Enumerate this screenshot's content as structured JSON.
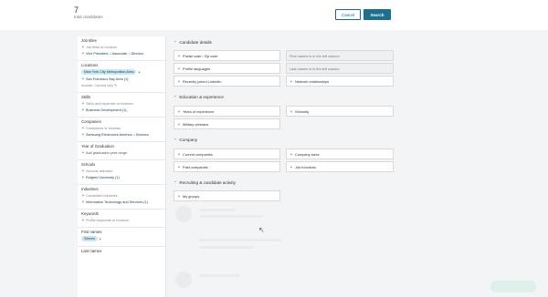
{
  "header": {
    "count": "7",
    "count_label": "total candidates",
    "cancel_label": "Cancel",
    "search_label": "Search"
  },
  "sidebar": {
    "job_titles": {
      "title": "Job titles",
      "placeholder": "Job titles or boolean",
      "value": "Vice President, • Associate, • Director,"
    },
    "locations": {
      "title": "Locations",
      "pill": "New York City Metropolitan Area",
      "value": "San Francisco Bay Area (1),",
      "include": "Include: Current only"
    },
    "skills": {
      "title": "Skills",
      "placeholder": "Skills and expertise or boolean",
      "value": "Business Development (1),"
    },
    "companies": {
      "title": "Companies",
      "placeholder": "Companies or boolean",
      "value": "Samsung Electronics America, • Nomura,"
    },
    "year_of_graduation": {
      "title": "Year of Graduation",
      "add": "Add graduation year range"
    },
    "schools": {
      "title": "Schools",
      "placeholder": "Schools attended",
      "value": "Rutgers University (1)"
    },
    "industries": {
      "title": "Industries",
      "placeholder": "Candidate industries",
      "value": "Information Technology and Services (1)"
    },
    "keywords": {
      "title": "Keywords",
      "placeholder": "Profile keywords or boolean"
    },
    "first_names": {
      "title": "First names",
      "pill": "Steven"
    },
    "last_names": {
      "title": "Last names"
    }
  },
  "main": {
    "candidate_details": {
      "title": "Candidate details",
      "postal": "Postal code / Zip code",
      "first_names_note": "First names is in the left column",
      "profile_languages": "Profile languages",
      "last_names_note": "Last names is in the left column",
      "recently_joined": "Recently joined LinkedIn",
      "network": "Network relationships"
    },
    "education": {
      "title": "Education & experience",
      "years": "Years of experience",
      "seniority": "Seniority",
      "military": "Military veterans"
    },
    "company": {
      "title": "Company",
      "current": "Current companies",
      "sizes": "Company sizes",
      "past": "Past companies",
      "functions": "Job functions"
    },
    "recruiting": {
      "title": "Recruiting & candidate activity",
      "groups": "My groups"
    }
  },
  "colors": {
    "accent": "#0a66c2",
    "primary_button": "#1e6f8c",
    "pill_bg": "#cce6f4"
  }
}
